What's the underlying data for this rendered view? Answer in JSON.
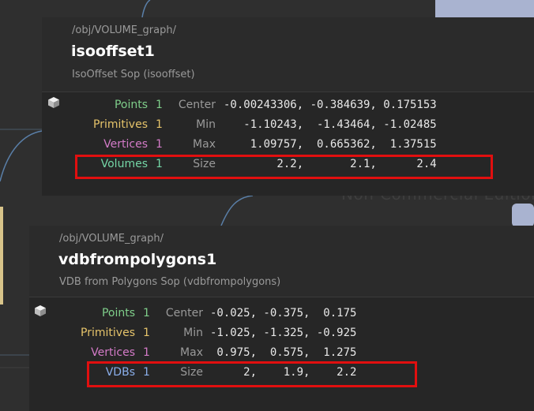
{
  "watermark": "Non-Commercial Edition",
  "panels": [
    {
      "path": "/obj/VOLUME_graph/",
      "node_name": "isooffset1",
      "node_type": "IsoOffset Sop (isooffset)",
      "rows": [
        {
          "label": "Points",
          "count": "1",
          "key": "Center",
          "values": "-0.00243306, -0.384639, 0.175153"
        },
        {
          "label": "Primitives",
          "count": "1",
          "key": "Min",
          "values": "   -1.10243,  -1.43464, -1.02485"
        },
        {
          "label": "Vertices",
          "count": "1",
          "key": "Max",
          "values": "    1.09757,  0.665362,  1.37515"
        },
        {
          "label": "Volumes",
          "count": "1",
          "key": "Size",
          "values": "        2.2,       2.1,      2.4"
        }
      ]
    },
    {
      "path": "/obj/VOLUME_graph/",
      "node_name": "vdbfrompolygons1",
      "node_type": "VDB from Polygons Sop (vdbfrompolygons)",
      "rows": [
        {
          "label": "Points",
          "count": "1",
          "key": "Center",
          "values": "-0.025, -0.375,  0.175"
        },
        {
          "label": "Primitives",
          "count": "1",
          "key": "Min",
          "values": "-1.025, -1.325, -0.925"
        },
        {
          "label": "Vertices",
          "count": "1",
          "key": "Max",
          "values": " 0.975,  0.575,  1.275"
        },
        {
          "label": "VDBs",
          "count": "1",
          "key": "Size",
          "values": "     2,    1.9,    2.2"
        }
      ]
    }
  ],
  "colors": {
    "points": "#7fce8a",
    "primitives": "#e5c36a",
    "vertices": "#d47bc8",
    "volumes": "#74d6a6",
    "vdbs": "#8aaeea",
    "highlight": "#e10f0f"
  }
}
